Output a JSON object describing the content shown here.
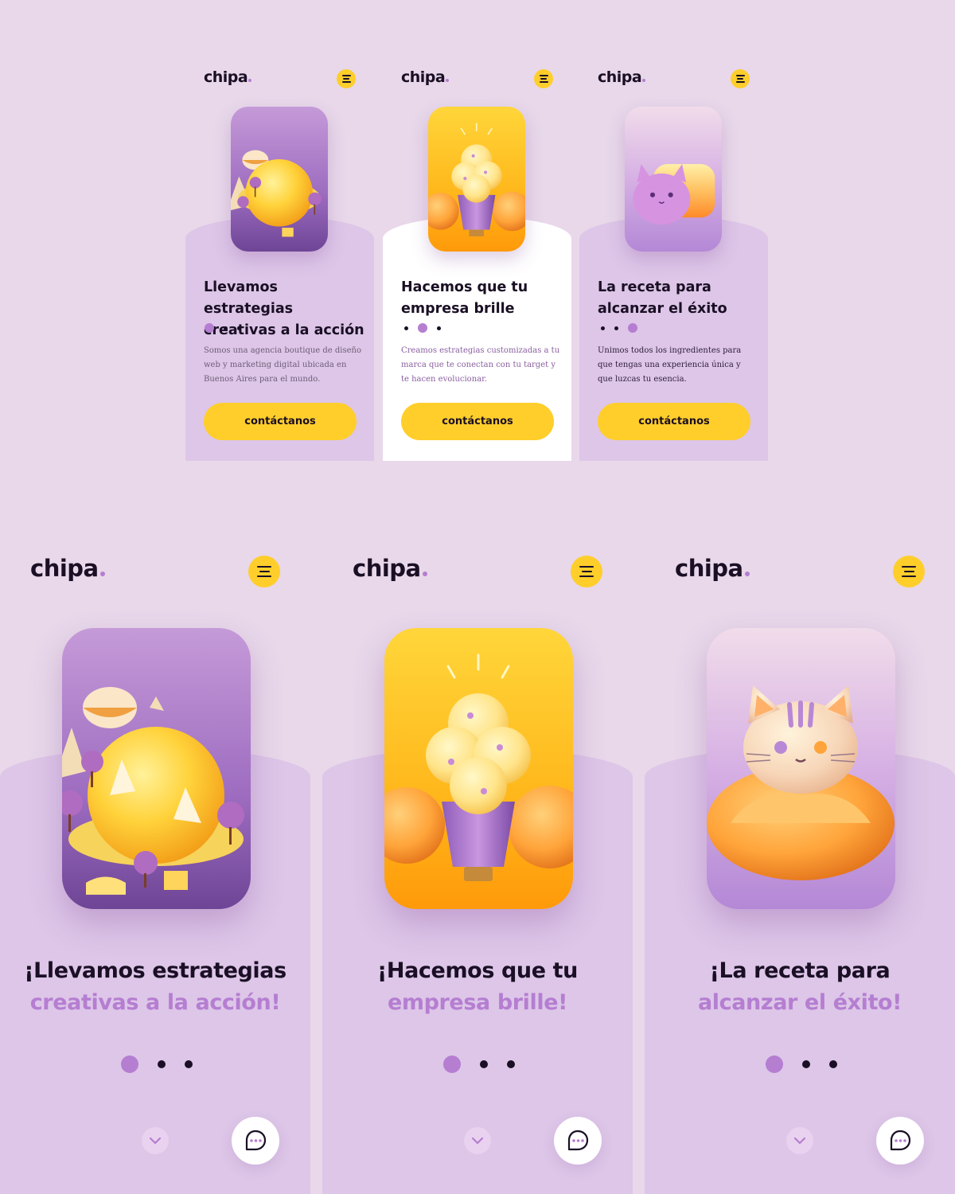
{
  "brand": {
    "logo_text": "chipa"
  },
  "colors": {
    "background": "#e8d8ea",
    "panel": "#ddc6e8",
    "accent_purple": "#b57ed1",
    "accent_yellow": "#ffce2b",
    "text_dark": "#1a0f24"
  },
  "icons": {
    "menu": "hamburger-menu-icon",
    "scroll": "chevron-down-icon",
    "chat": "chat-bubble-icon"
  },
  "small_screens": [
    {
      "title_line1": "Llevamos estrategias",
      "title_line2": "creativas a la acción",
      "description": "Somos una agencia boutique de diseño web y marketing digital ubicada en Buenos Aires para el mundo.",
      "cta_label": "contáctanos",
      "active_dot": 1,
      "illustration": "planet-island"
    },
    {
      "title_line1": "Hacemos que tu",
      "title_line2": "empresa brille",
      "description": "Creamos estrategias customizadas a tu marca que te conectan con tu target y te hacen evolucionar.",
      "cta_label": "contáctanos",
      "active_dot": 2,
      "illustration": "light-bulb"
    },
    {
      "title_line1": "La receta para",
      "title_line2": "alcanzar el éxito",
      "description": "Unimos todos los ingredientes para que tengas una experiencia única y que luzcas tu esencia.",
      "cta_label": "contáctanos",
      "active_dot": 3,
      "illustration": "bread-cat"
    }
  ],
  "large_screens": [
    {
      "title_line1": "¡Llevamos estrategias",
      "title_line2": "creativas a la acción!",
      "active_dot": 1,
      "illustration": "planet-island"
    },
    {
      "title_line1": "¡Hacemos que tu",
      "title_line2": "empresa brille!",
      "active_dot": 1,
      "illustration": "light-bulb"
    },
    {
      "title_line1": "¡La receta para",
      "title_line2": "alcanzar el éxito!",
      "active_dot": 1,
      "illustration": "bread-cat"
    }
  ]
}
